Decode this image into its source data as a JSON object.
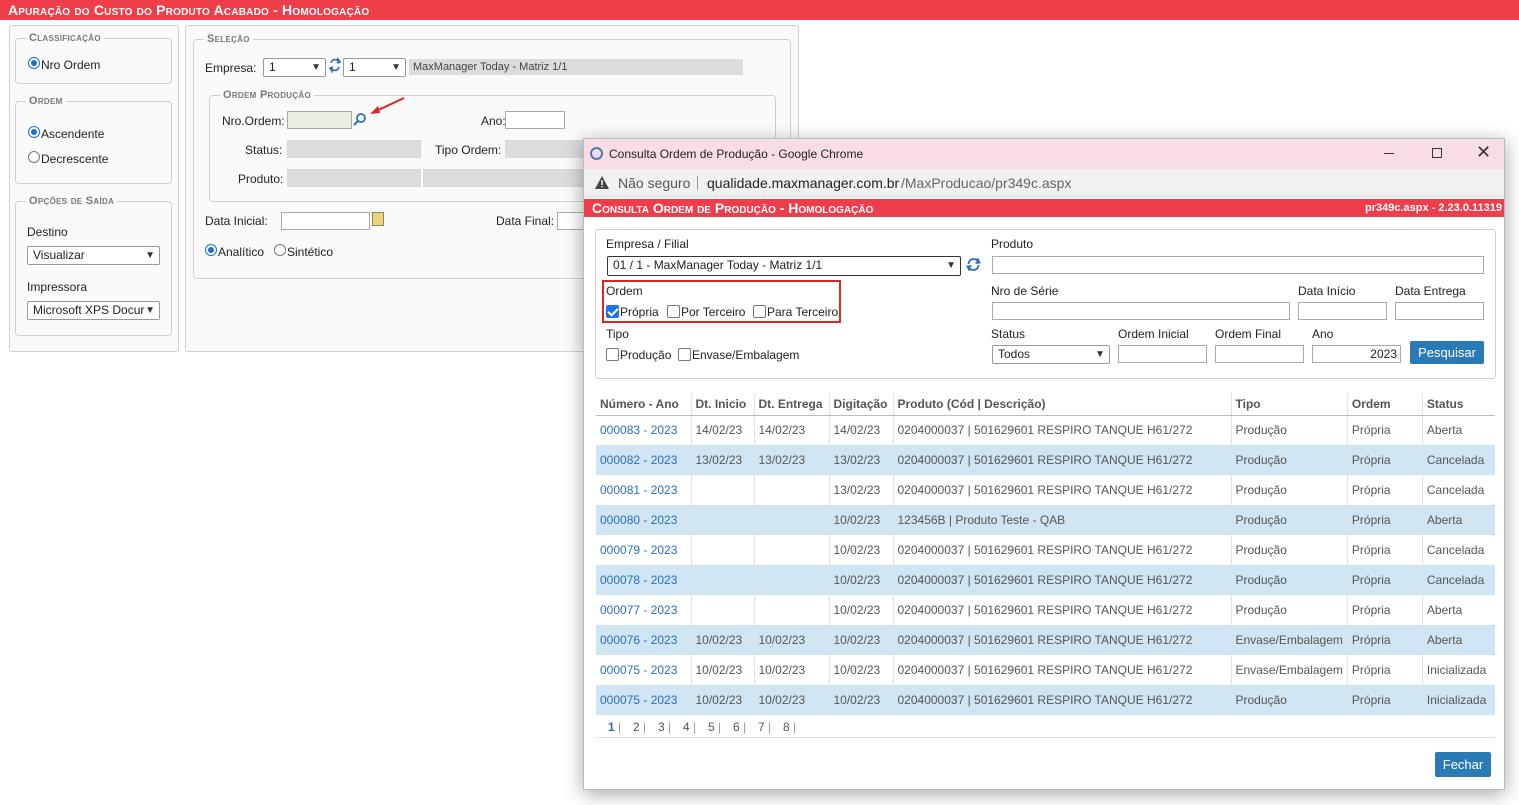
{
  "page_title": "Apuração do Custo do Produto Acabado  - Homologação",
  "classificacao": {
    "legend": "Classificação",
    "option": "Nro Ordem"
  },
  "ordem": {
    "legend": "Ordem",
    "asc": "Ascendente",
    "desc": "Decrescente"
  },
  "saida": {
    "legend": "Opções de Saída",
    "destino_label": "Destino",
    "destino_value": "Visualizar",
    "impressora_label": "Impressora",
    "impressora_value": "Microsoft XPS Docur"
  },
  "selecao": {
    "legend": "Seleção",
    "empresa_label": "Empresa:",
    "empresa_value": "1",
    "filial_value": "1",
    "empresa_desc": "MaxManager Today - Matriz 1/1",
    "op_legend": "Ordem Produção",
    "nro_ordem_label": "Nro.Ordem:",
    "ano_label": "Ano:",
    "status_label": "Status:",
    "tipo_ordem_label": "Tipo Ordem:",
    "produto_label": "Produto:",
    "data_inicial_label": "Data Inicial:",
    "data_final_label": "Data Final:",
    "analitico": "Analítico",
    "sintetico": "Sintético"
  },
  "popup": {
    "window_title": "Consulta Ordem de Produção - Google Chrome",
    "not_secure": "Não seguro",
    "url_domain": "qualidade.maxmanager.com.br",
    "url_path": "/MaxProducao/pr349c.aspx",
    "inner_title": "Consulta Ordem de Produção  - Homologação",
    "version": "pr349c.aspx - 2.23.0.11319",
    "filters": {
      "empresa_label": "Empresa / Filial",
      "empresa_value": "01 / 1 - MaxManager Today - Matriz 1/1",
      "produto_label": "Produto",
      "ordem_label": "Ordem",
      "ordem_options": [
        "Própria",
        "Por Terceiro",
        "Para Terceiro"
      ],
      "tipo_label": "Tipo",
      "tipo_options": [
        "Produção",
        "Envase/Embalagem"
      ],
      "nro_serie_label": "Nro de Série",
      "data_inicio_label": "Data Início",
      "data_entrega_label": "Data Entrega",
      "status_label": "Status",
      "status_value": "Todos",
      "ordem_inicial_label": "Ordem Inicial",
      "ordem_final_label": "Ordem Final",
      "ano_label": "Ano",
      "ano_value": "2023",
      "search_button": "Pesquisar"
    },
    "columns": [
      "Número - Ano",
      "Dt. Inicio",
      "Dt. Entrega",
      "Digitação",
      "Produto (Cód | Descrição)",
      "Tipo",
      "Ordem",
      "Status"
    ],
    "rows": [
      {
        "num": "000083 - 2023",
        "inicio": "14/02/23",
        "entrega": "14/02/23",
        "digitacao": "14/02/23",
        "produto": "0204000037 | 501629601 RESPIRO TANQUE H61/272",
        "tipo": "Produção",
        "ordem": "Própria",
        "status": "Aberta"
      },
      {
        "num": "000082 - 2023",
        "inicio": "13/02/23",
        "entrega": "13/02/23",
        "digitacao": "13/02/23",
        "produto": "0204000037 | 501629601 RESPIRO TANQUE H61/272",
        "tipo": "Produção",
        "ordem": "Própria",
        "status": "Cancelada"
      },
      {
        "num": "000081 - 2023",
        "inicio": "",
        "entrega": "",
        "digitacao": "13/02/23",
        "produto": "0204000037 | 501629601 RESPIRO TANQUE H61/272",
        "tipo": "Produção",
        "ordem": "Própria",
        "status": "Cancelada"
      },
      {
        "num": "000080 - 2023",
        "inicio": "",
        "entrega": "",
        "digitacao": "10/02/23",
        "produto": "123456B | Produto Teste - QAB",
        "tipo": "Produção",
        "ordem": "Própria",
        "status": "Aberta"
      },
      {
        "num": "000079 - 2023",
        "inicio": "",
        "entrega": "",
        "digitacao": "10/02/23",
        "produto": "0204000037 | 501629601 RESPIRO TANQUE H61/272",
        "tipo": "Produção",
        "ordem": "Própria",
        "status": "Cancelada"
      },
      {
        "num": "000078 - 2023",
        "inicio": "",
        "entrega": "",
        "digitacao": "10/02/23",
        "produto": "0204000037 | 501629601 RESPIRO TANQUE H61/272",
        "tipo": "Produção",
        "ordem": "Própria",
        "status": "Cancelada"
      },
      {
        "num": "000077 - 2023",
        "inicio": "",
        "entrega": "",
        "digitacao": "10/02/23",
        "produto": "0204000037 | 501629601 RESPIRO TANQUE H61/272",
        "tipo": "Produção",
        "ordem": "Própria",
        "status": "Aberta"
      },
      {
        "num": "000076 - 2023",
        "inicio": "10/02/23",
        "entrega": "10/02/23",
        "digitacao": "10/02/23",
        "produto": "0204000037 | 501629601 RESPIRO TANQUE H61/272",
        "tipo": "Envase/Embalagem",
        "ordem": "Própria",
        "status": "Aberta"
      },
      {
        "num": "000075 - 2023",
        "inicio": "10/02/23",
        "entrega": "10/02/23",
        "digitacao": "10/02/23",
        "produto": "0204000037 | 501629601 RESPIRO TANQUE H61/272",
        "tipo": "Envase/Embalagem",
        "ordem": "Própria",
        "status": "Inicializada"
      },
      {
        "num": "000075 - 2023",
        "inicio": "10/02/23",
        "entrega": "10/02/23",
        "digitacao": "10/02/23",
        "produto": "0204000037 | 501629601 RESPIRO TANQUE H61/272",
        "tipo": "Produção",
        "ordem": "Própria",
        "status": "Inicializada"
      }
    ],
    "pages": [
      "1",
      "2",
      "3",
      "4",
      "5",
      "6",
      "7",
      "8"
    ],
    "close_button": "Fechar"
  }
}
